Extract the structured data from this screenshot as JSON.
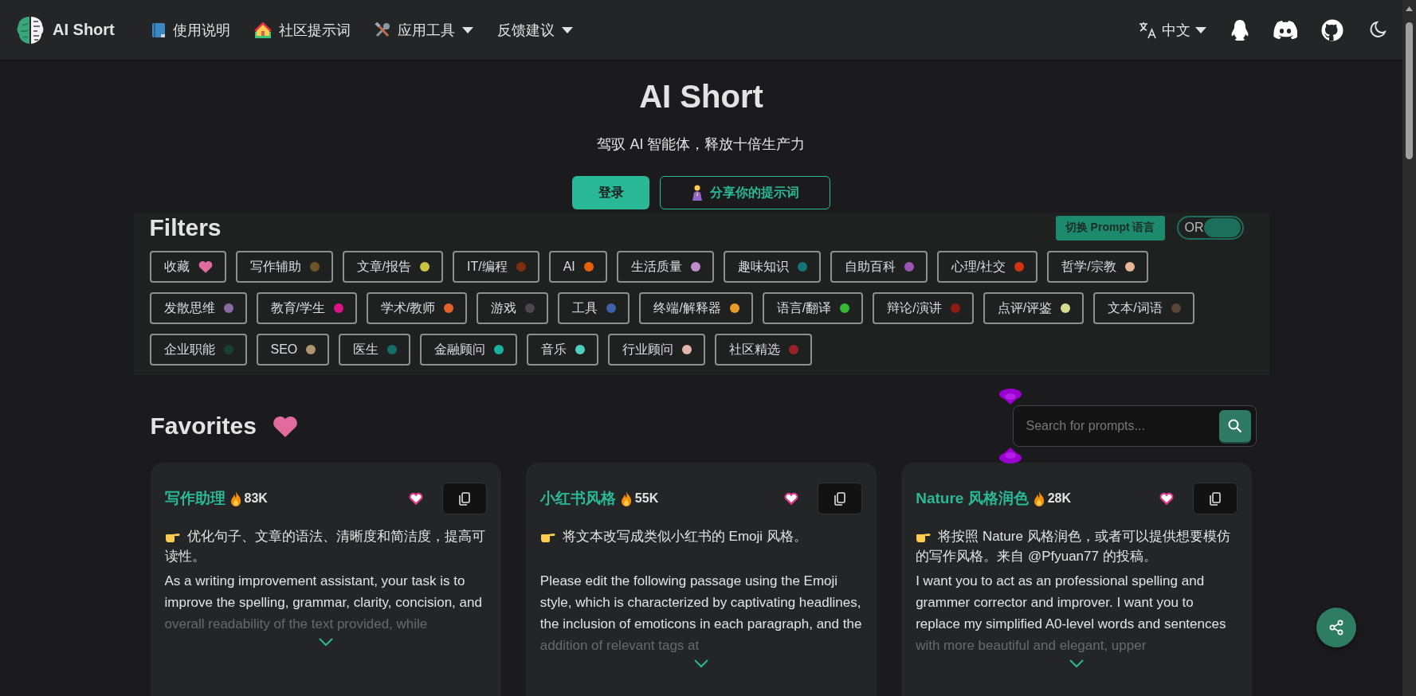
{
  "navbar": {
    "brand": "AI Short",
    "links": [
      {
        "label": "使用说明",
        "dropdown": false
      },
      {
        "label": "社区提示词",
        "dropdown": false
      },
      {
        "label": "应用工具",
        "dropdown": true
      },
      {
        "label": "反馈建议",
        "dropdown": true
      }
    ],
    "language": {
      "label": "中文",
      "dropdown": true
    }
  },
  "hero": {
    "title": "AI Short",
    "subtitle": "驾驭 AI 智能体，释放十倍生产力",
    "buttons": [
      {
        "label": "登录",
        "kind": "primary"
      },
      {
        "label": "分享你的提示词",
        "kind": "outline"
      }
    ]
  },
  "filters": {
    "title": "Filters",
    "language_button": "切换 Prompt 语言",
    "operator_toggle": {
      "label": "OR",
      "on": true
    },
    "tags": [
      {
        "label": "收藏",
        "kind": "favorite",
        "color": "#e26b9d"
      },
      {
        "label": "写作辅助",
        "kind": "category",
        "color": "#6e5526"
      },
      {
        "label": "文章/报告",
        "kind": "category",
        "color": "#c9c540"
      },
      {
        "label": "IT/编程",
        "kind": "category",
        "color": "#7a2e0e"
      },
      {
        "label": "AI",
        "kind": "category",
        "color": "#e8610a"
      },
      {
        "label": "生活质量",
        "kind": "category",
        "color": "#c08ccc"
      },
      {
        "label": "趣味知识",
        "kind": "category",
        "color": "#137577"
      },
      {
        "label": "自助百科",
        "kind": "category",
        "color": "#9b55b4"
      },
      {
        "label": "心理/社交",
        "kind": "category",
        "color": "#d4310f"
      },
      {
        "label": "哲学/宗教",
        "kind": "category",
        "color": "#e8b799"
      },
      {
        "label": "发散思维",
        "kind": "category",
        "color": "#8a6aa0"
      },
      {
        "label": "教育/学生",
        "kind": "category",
        "color": "#e0128a"
      },
      {
        "label": "学术/教师",
        "kind": "category",
        "color": "#e4612c"
      },
      {
        "label": "游戏",
        "kind": "category",
        "color": "#4e464e"
      },
      {
        "label": "工具",
        "kind": "category",
        "color": "#3f61a8"
      },
      {
        "label": "终端/解释器",
        "kind": "category",
        "color": "#e89a26"
      },
      {
        "label": "语言/翻译",
        "kind": "category",
        "color": "#34b734"
      },
      {
        "label": "辩论/演讲",
        "kind": "category",
        "color": "#8e1c12"
      },
      {
        "label": "点评/评鉴",
        "kind": "category",
        "color": "#d6dc8f"
      },
      {
        "label": "文本/词语",
        "kind": "category",
        "color": "#5a4438"
      },
      {
        "label": "企业职能",
        "kind": "category",
        "color": "#173f3a"
      },
      {
        "label": "SEO",
        "kind": "category",
        "color": "#b29470"
      },
      {
        "label": "医生",
        "kind": "category",
        "color": "#136e69"
      },
      {
        "label": "金融顾问",
        "kind": "category",
        "color": "#19b2a0"
      },
      {
        "label": "音乐",
        "kind": "category",
        "color": "#50d0c0"
      },
      {
        "label": "行业顾问",
        "kind": "category",
        "color": "#e2b6a8"
      },
      {
        "label": "社区精选",
        "kind": "category",
        "color": "#9a2228"
      }
    ]
  },
  "favorites": {
    "title": "Favorites",
    "search": {
      "placeholder": "Search for prompts..."
    },
    "cards": [
      {
        "title": "写作助理",
        "count": "83K",
        "description": "优化句子、文章的语法、清晰度和简洁度，提高可读性。",
        "prompt": "As a writing improvement assistant, your task is to improve the spelling, grammar, clarity, concision, and overall readability of the text provided, while"
      },
      {
        "title": "小红书风格",
        "count": "55K",
        "description": "将文本改写成类似小红书的 Emoji 风格。",
        "prompt": "Please edit the following passage using the Emoji style, which is characterized by captivating headlines, the inclusion of emoticons in each paragraph, and the addition of relevant tags at"
      },
      {
        "title": "Nature 风格润色",
        "count": "28K",
        "description": "将按照 Nature 风格润色，或者可以提供想要模仿的写作风格。来自 @Pfyuan77 的投稿。",
        "prompt": "I want you to act as an professional spelling and grammer corrector and improver. I want you to replace my simplified A0-level words and sentences with more beautiful and elegant, upper"
      }
    ]
  }
}
